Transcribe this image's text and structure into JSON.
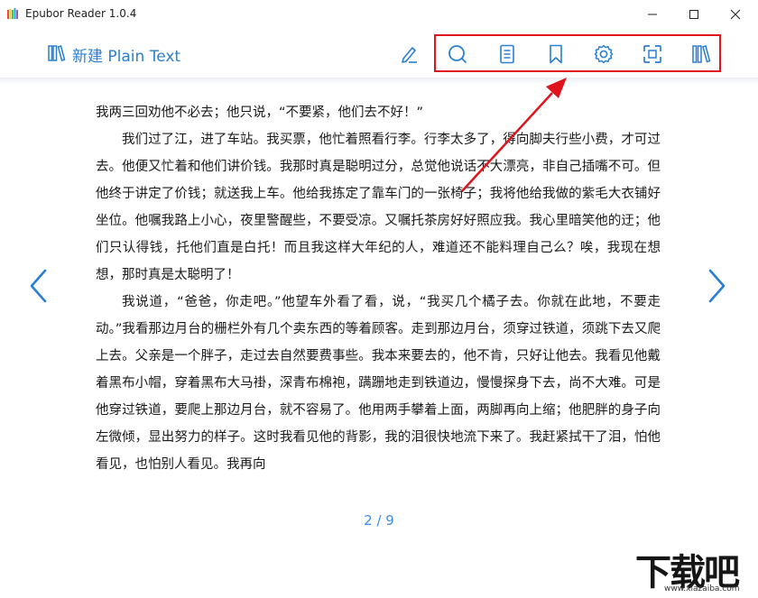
{
  "window": {
    "title": "Epubor Reader 1.0.4"
  },
  "header": {
    "doc_title": "新建 Plain Text"
  },
  "toolbar": {
    "icons": [
      "search-icon",
      "toc-icon",
      "bookmark-icon",
      "settings-icon",
      "fullscreen-icon",
      "library-icon"
    ],
    "highlight_color": "#e0141c"
  },
  "theme": {
    "accent": "#2a7fd4"
  },
  "content": {
    "paragraphs": [
      "我两三回劝他不必去；他只说，“不要紧，他们去不好！”",
      "我们过了江，进了车站。我买票，他忙着照看行李。行李太多了，得向脚夫行些小费，才可过去。他便又忙着和他们讲价钱。我那时真是聪明过分，总觉他说话不大漂亮，非自己插嘴不可。但他终于讲定了价钱；就送我上车。他给我拣定了靠车门的一张椅子；我将他给我做的紫毛大衣铺好坐位。他嘱我路上小心，夜里警醒些，不要受凉。又嘱托茶房好好照应我。我心里暗笑他的迂；他们只认得钱，托他们直是白托！而且我这样大年纪的人，难道还不能料理自己么？唉，我现在想想，那时真是太聪明了！",
      "我说道，“爸爸，你走吧。”他望车外看了看，说，“我买几个橘子去。你就在此地，不要走动。”我看那边月台的栅栏外有几个卖东西的等着顾客。走到那边月台，须穿过铁道，须跳下去又爬上去。父亲是一个胖子，走过去自然要费事些。我本来要去的，他不肯，只好让他去。我看见他戴着黑布小帽，穿着黑布大马褂，深青布棉袍，蹒跚地走到铁道边，慢慢探身下去，尚不大难。可是他穿过铁道，要爬上那边月台，就不容易了。他用两手攀着上面，两脚再向上缩；他肥胖的身子向左微倾，显出努力的样子。这时我看见他的背影，我的泪很快地流下来了。我赶紧拭干了泪，怕他看见，也怕别人看见。我再向"
    ]
  },
  "pagination": {
    "indicator": "2 / 9"
  },
  "watermark": {
    "brand": "下载吧",
    "url": "www.xiazaiba.com"
  }
}
